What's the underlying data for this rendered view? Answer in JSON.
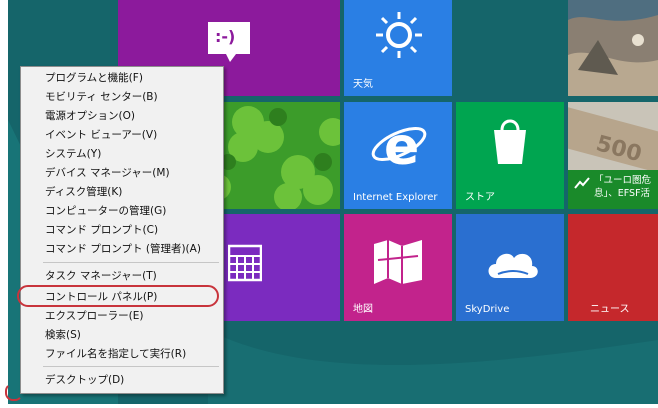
{
  "tiles": {
    "weather": "天気",
    "internet_explorer": "Internet Explorer",
    "store": "ストア",
    "maps": "地図",
    "skydrive": "SkyDrive",
    "news": "ニュース",
    "messaging_emoticon": ":-)",
    "finance_news_line1": "「ユーロ圏危",
    "finance_news_line2": "息」、EFSF活"
  },
  "context_menu": {
    "items": [
      "プログラムと機能(F)",
      "モビリティ センター(B)",
      "電源オプション(O)",
      "イベント ビューアー(V)",
      "システム(Y)",
      "デバイス マネージャー(M)",
      "ディスク管理(K)",
      "コンピューターの管理(G)",
      "コマンド プロンプト(C)",
      "コマンド プロンプト (管理者)(A)",
      "タスク マネージャー(T)",
      "コントロール パネル(P)",
      "エクスプローラー(E)",
      "検索(S)",
      "ファイル名を指定して実行(R)",
      "デスクトップ(D)"
    ]
  },
  "colors": {
    "start_background": "#15656a",
    "highlight": "#c8343c",
    "menu_background": "#f1f1f1"
  }
}
